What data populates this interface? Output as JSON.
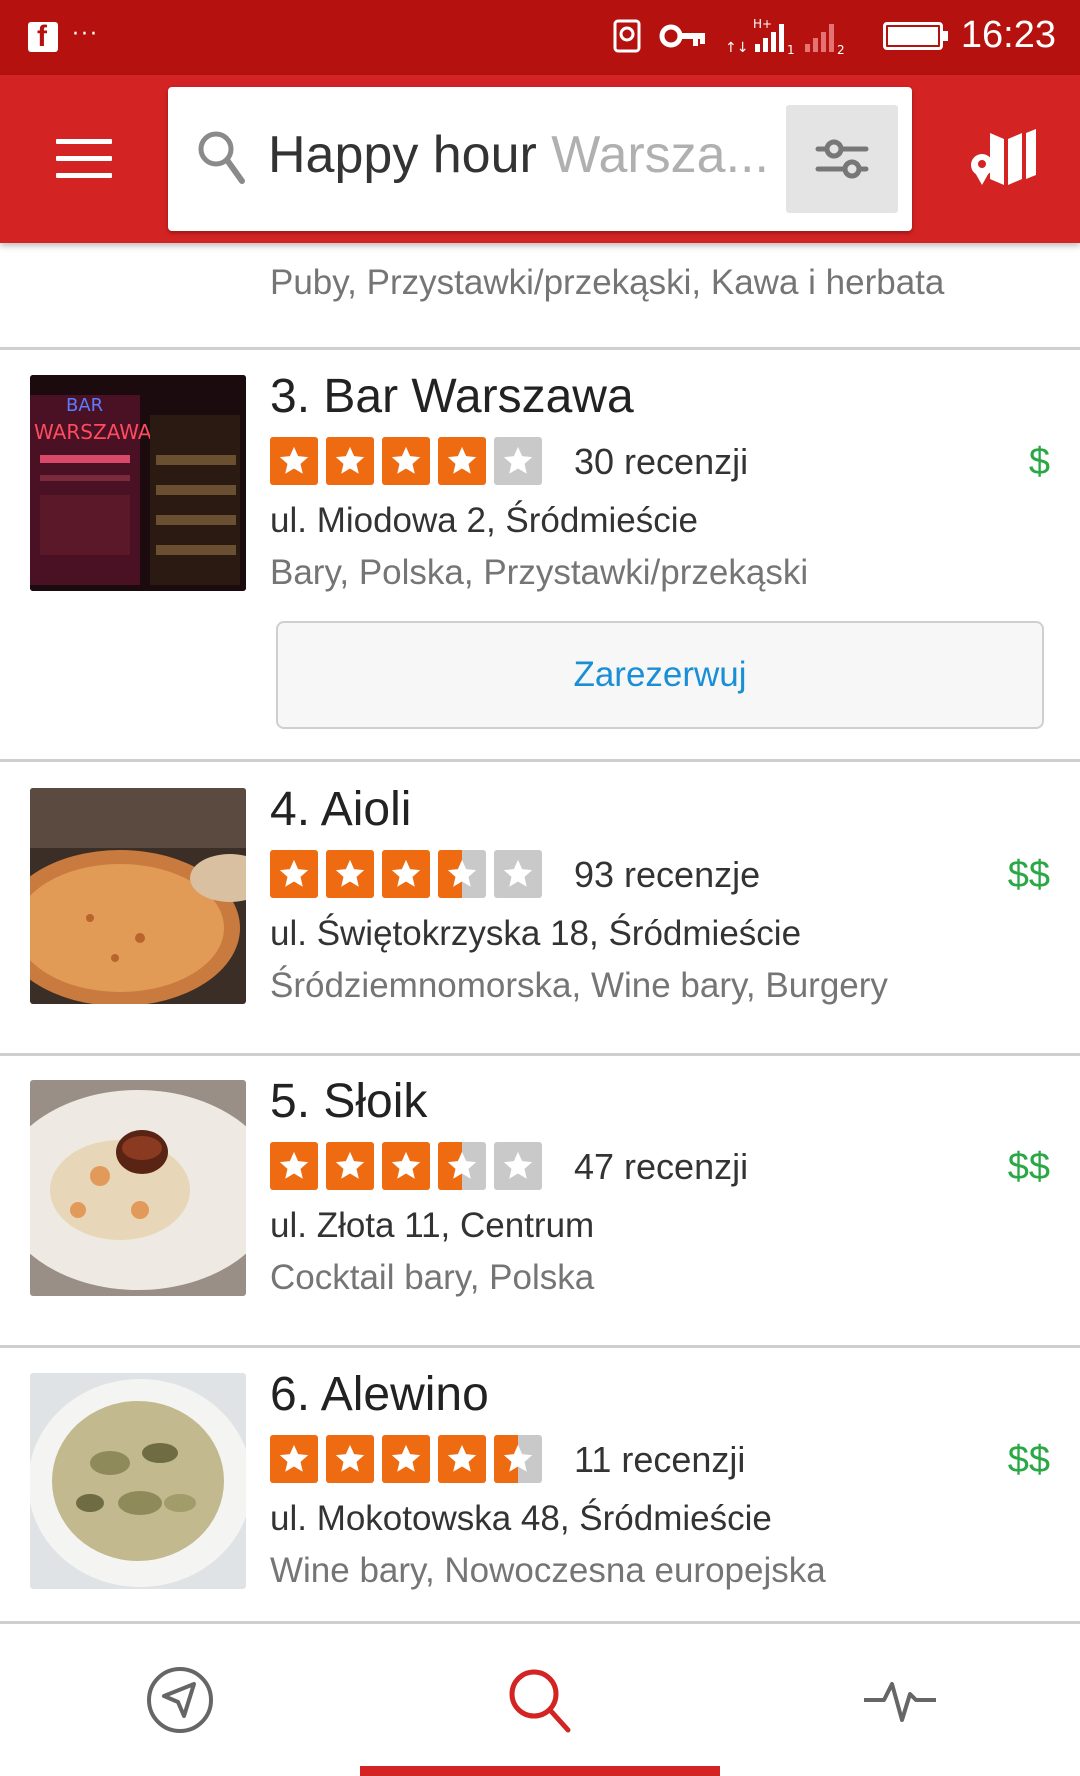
{
  "status_bar": {
    "time": "16:23",
    "icons": [
      "facebook-icon",
      "more-dots-icon",
      "screenshot-icon",
      "key-icon",
      "signal-icon",
      "battery-icon"
    ]
  },
  "search": {
    "term": "Happy hour",
    "location": "Warsza..."
  },
  "partial_item": {
    "categories": "Puby, Przystawki/przekąski, Kawa i herbata"
  },
  "items": [
    {
      "title": "3. Bar Warszawa",
      "rating": 4,
      "reviews": "30 recenzji",
      "price": "$",
      "address": "ul. Miodowa 2, Śródmieście",
      "categories": "Bary, Polska, Przystawki/przekąski",
      "reserve_label": "Zarezerwuj"
    },
    {
      "title": "4. Aioli",
      "rating": 3.5,
      "reviews": "93 recenzje",
      "price": "$$",
      "address": "ul. Świętokrzyska 18, Śródmieście",
      "categories": "Śródziemnomorska, Wine bary, Burgery"
    },
    {
      "title": "5. Słoik",
      "rating": 3.5,
      "reviews": "47 recenzji",
      "price": "$$",
      "address": "ul. Złota 11, Centrum",
      "categories": "Cocktail bary, Polska"
    },
    {
      "title": "6. Alewino",
      "rating": 4.5,
      "reviews": "11 recenzji",
      "price": "$$",
      "address": "ul. Mokotowska 48, Śródmieście",
      "categories": "Wine bary, Nowoczesna europejska"
    }
  ],
  "bottom_nav": {
    "tabs": [
      "nearby-icon",
      "search-icon",
      "activity-icon"
    ],
    "active": "search-icon"
  },
  "colors": {
    "brand_red": "#d32323",
    "status_red": "#b5120f",
    "star_orange": "#ee6b12",
    "price_green": "#2aa845",
    "link_blue": "#1a8fd6"
  }
}
